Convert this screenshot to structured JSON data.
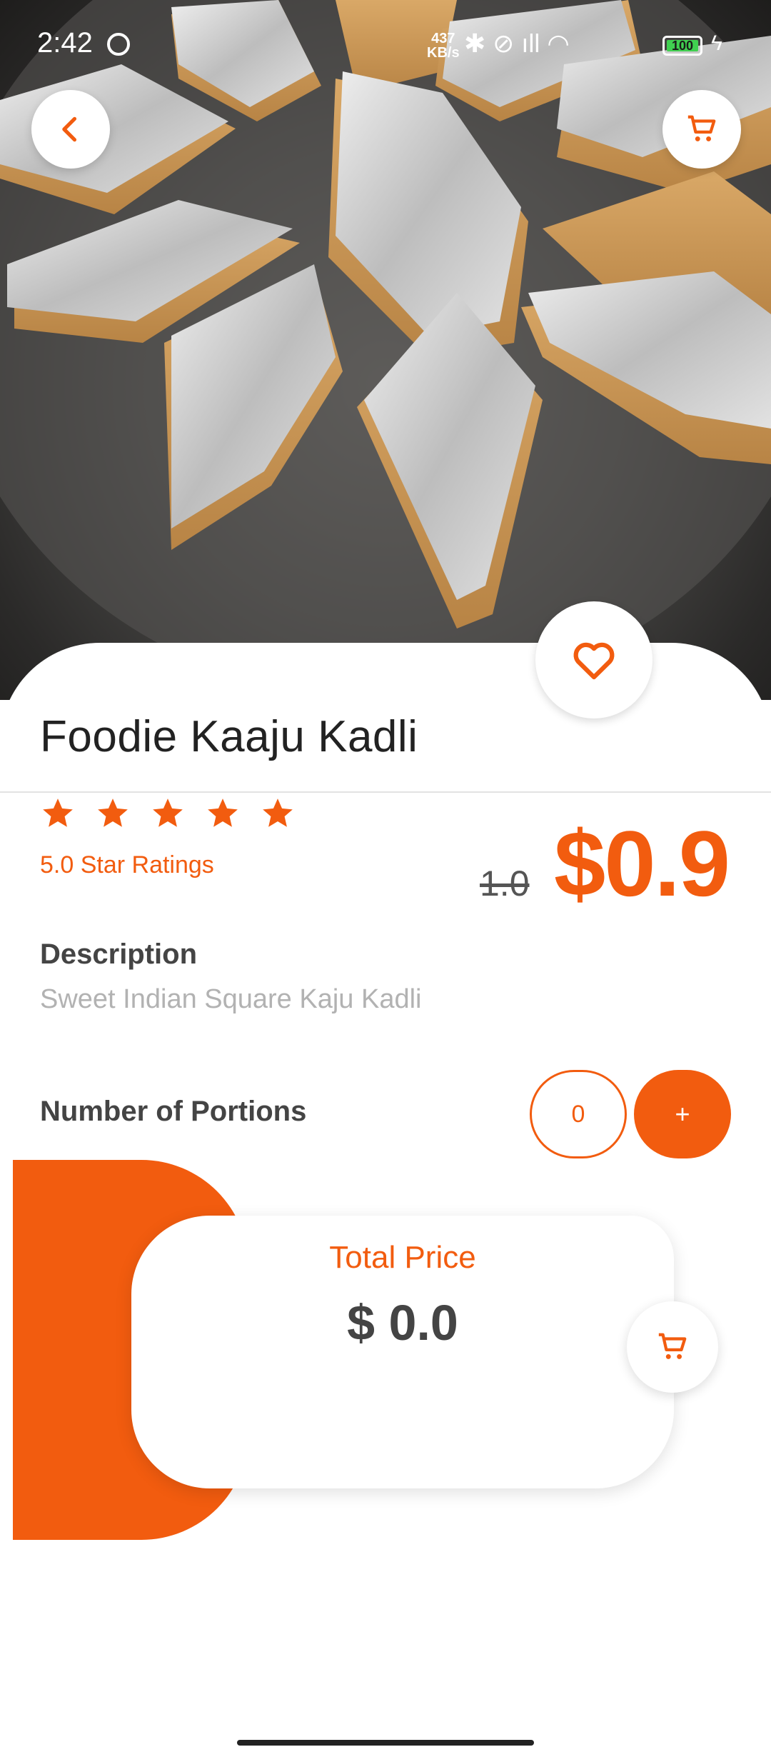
{
  "status_bar": {
    "time": "2:42",
    "net_speed": "437\nKB/s",
    "icons_text": "✱ ⊘ ıll ◠",
    "battery": "100"
  },
  "product": {
    "name": "Foodie Kaaju Kadli",
    "rating_text": "5.0 Star Ratings",
    "star_count": 5,
    "old_price": "1.0",
    "price": "$0.9",
    "description_heading": "Description",
    "description": "Sweet Indian Square Kaju Kadli"
  },
  "portions": {
    "label": "Number of Portions",
    "quantity": "0",
    "plus_label": "+"
  },
  "total": {
    "label": "Total Price",
    "value": "$ 0.0"
  },
  "colors": {
    "accent": "#f25c0f",
    "text_dark": "#444444",
    "text_muted": "#b2b2b2"
  },
  "icons": {
    "back": "chevron-left-icon",
    "cart": "cart-icon",
    "favorite": "heart-icon",
    "star": "star-icon"
  }
}
